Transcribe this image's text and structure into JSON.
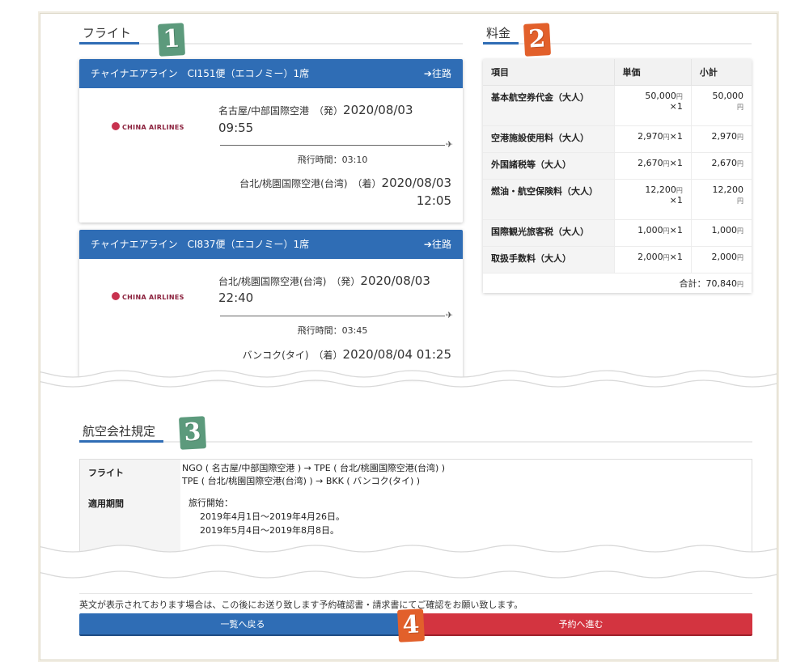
{
  "sections": {
    "flight": "フライト",
    "fare": "料金",
    "rules": "航空会社規定"
  },
  "badges": [
    "1",
    "2",
    "3",
    "4"
  ],
  "flights": [
    {
      "header": "チャイナエアライン　CI151便（エコノミー）1席",
      "direction": "往路",
      "airline_logo": "CHINA AIRLINES",
      "dep_place": "名古屋/中部国際空港　（発）",
      "dep_date": "2020/08/03",
      "dep_time": "09:55",
      "duration": "飛行時間：03:10",
      "arr_place": "台北/桃園国際空港(台湾)　（着）",
      "arr_date": "2020/08/03",
      "arr_time": "12:05"
    },
    {
      "header": "チャイナエアライン　CI837便（エコノミー）1席",
      "direction": "往路",
      "airline_logo": "CHINA AIRLINES",
      "dep_place": "台北/桃園国際空港(台湾)　（発）",
      "dep_date": "2020/08/03",
      "dep_time": "22:40",
      "duration": "飛行時間：03:45",
      "arr_place": "バンコク(タイ)　（着）",
      "arr_datetime": "2020/08/04 01:25"
    }
  ],
  "fare": {
    "headers": [
      "項目",
      "単価",
      "小計"
    ],
    "rows": [
      {
        "item": "基本航空券代金（大人）",
        "unit_price": "50,000",
        "yen": "円",
        "qty": "×1",
        "subtotal": "50,000",
        "subtotal_yen": "円"
      },
      {
        "item": "空港施設使用料（大人）",
        "unit_price": "2,970",
        "yen": "円",
        "qty": "×1",
        "subtotal": "2,970",
        "subtotal_yen": "円"
      },
      {
        "item": "外国諸税等（大人）",
        "unit_price": "2,670",
        "yen": "円",
        "qty": "×1",
        "subtotal": "2,670",
        "subtotal_yen": "円"
      },
      {
        "item": "燃油・航空保険料（大人）",
        "unit_price": "12,200",
        "yen": "円",
        "qty": "×1",
        "subtotal": "12,200",
        "subtotal_yen": "円"
      },
      {
        "item": "国際観光旅客税（大人）",
        "unit_price": "1,000",
        "yen": "円",
        "qty": "×1",
        "subtotal": "1,000",
        "subtotal_yen": "円"
      },
      {
        "item": "取扱手数料（大人）",
        "unit_price": "2,000",
        "yen": "円",
        "qty": "×1",
        "subtotal": "2,000",
        "subtotal_yen": "円"
      }
    ],
    "total_label": "合計：",
    "total_value": "70,840",
    "total_yen": "円"
  },
  "rules": {
    "flight_label": "フライト",
    "flight_lines": [
      "NGO ( 名古屋/中部国際空港 ) → TPE ( 台北/桃園国際空港(台湾) )",
      "TPE ( 台北/桃園国際空港(台湾) ) → BKK ( バンコク(タイ) )"
    ],
    "period_label": "適用期間",
    "period_lines": [
      "旅行開始：",
      "2019年4月1日～2019年4月26日。",
      "2019年5月4日～2019年8月8日。"
    ]
  },
  "notice": "英文が表示されております場合は、この後にお送り致します予約確認書・請求書にてご確認をお願い致します。",
  "buttons": {
    "back": "一覧へ戻る",
    "next": "予約へ進む"
  },
  "colors": {
    "primary": "#2f6db5",
    "danger": "#d33440",
    "badge_green": "#5c9a7c",
    "badge_orange": "#e2602b"
  }
}
